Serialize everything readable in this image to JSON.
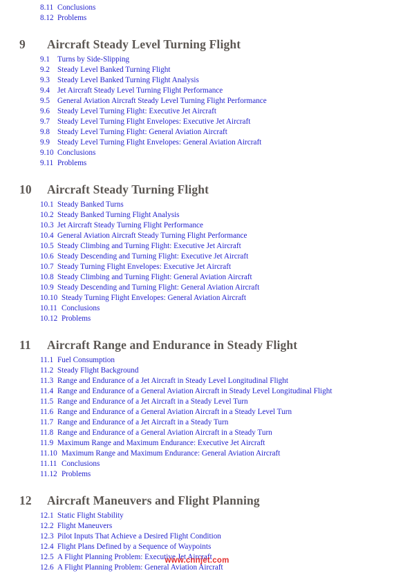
{
  "colors": {
    "section_blue": "#1f1fcc",
    "chapter_gray": "#5c5753",
    "watermark_red": "#e01b1b",
    "page_background": "#ffffff"
  },
  "watermark": {
    "text": "www.cnnjet.com"
  },
  "toc": {
    "leading_sections": [
      {
        "number": "8.11",
        "title": "Conclusions"
      },
      {
        "number": "8.12",
        "title": "Problems"
      }
    ],
    "chapters": [
      {
        "number": "9",
        "title": "Aircraft Steady Level Turning Flight",
        "sections": [
          {
            "number": "9.1",
            "title": "Turns by Side-Slipping"
          },
          {
            "number": "9.2",
            "title": "Steady Level Banked Turning Flight"
          },
          {
            "number": "9.3",
            "title": "Steady Level Banked Turning Flight Analysis"
          },
          {
            "number": "9.4",
            "title": "Jet Aircraft Steady Level Turning Flight Performance"
          },
          {
            "number": "9.5",
            "title": "General Aviation Aircraft Steady Level Turning Flight Performance"
          },
          {
            "number": "9.6",
            "title": "Steady Level Turning Flight: Executive Jet Aircraft"
          },
          {
            "number": "9.7",
            "title": "Steady Level Turning Flight Envelopes: Executive Jet Aircraft"
          },
          {
            "number": "9.8",
            "title": "Steady Level Turning Flight: General Aviation Aircraft"
          },
          {
            "number": "9.9",
            "title": "Steady Level Turning Flight Envelopes: General Aviation Aircraft"
          },
          {
            "number": "9.10",
            "title": "Conclusions"
          },
          {
            "number": "9.11",
            "title": "Problems"
          }
        ]
      },
      {
        "number": "10",
        "title": "Aircraft Steady Turning Flight",
        "sections": [
          {
            "number": "10.1",
            "title": "Steady Banked Turns"
          },
          {
            "number": "10.2",
            "title": "Steady Banked Turning Flight Analysis"
          },
          {
            "number": "10.3",
            "title": "Jet Aircraft Steady Turning Flight Performance"
          },
          {
            "number": "10.4",
            "title": "General Aviation Aircraft Steady Turning Flight Performance"
          },
          {
            "number": "10.5",
            "title": "Steady Climbing and Turning Flight: Executive Jet Aircraft"
          },
          {
            "number": "10.6",
            "title": "Steady Descending and Turning Flight: Executive Jet Aircraft"
          },
          {
            "number": "10.7",
            "title": "Steady Turning Flight Envelopes: Executive Jet Aircraft"
          },
          {
            "number": "10.8",
            "title": "Steady Climbing and Turning Flight: General Aviation Aircraft"
          },
          {
            "number": "10.9",
            "title": "Steady Descending and Turning Flight: General Aviation Aircraft"
          },
          {
            "number": "10.10",
            "title": "Steady Turning Flight Envelopes: General Aviation Aircraft",
            "wide": true
          },
          {
            "number": "10.11",
            "title": "Conclusions",
            "wide": true
          },
          {
            "number": "10.12",
            "title": "Problems",
            "wide": true
          }
        ]
      },
      {
        "number": "11",
        "title": "Aircraft Range and Endurance in Steady Flight",
        "sections": [
          {
            "number": "11.1",
            "title": "Fuel Consumption"
          },
          {
            "number": "11.2",
            "title": "Steady Flight Background"
          },
          {
            "number": "11.3",
            "title": "Range and Endurance of a Jet Aircraft in Steady Level Longitudinal Flight"
          },
          {
            "number": "11.4",
            "title": "Range and Endurance of a General Aviation Aircraft in Steady Level Longitudinal Flight"
          },
          {
            "number": "11.5",
            "title": "Range and Endurance of a Jet Aircraft in a Steady Level Turn"
          },
          {
            "number": "11.6",
            "title": "Range and Endurance of a General Aviation Aircraft in a Steady Level Turn"
          },
          {
            "number": "11.7",
            "title": "Range and Endurance of a Jet Aircraft in a Steady Turn"
          },
          {
            "number": "11.8",
            "title": "Range and Endurance of a General Aviation Aircraft in a Steady Turn"
          },
          {
            "number": "11.9",
            "title": "Maximum Range and Maximum Endurance: Executive Jet Aircraft"
          },
          {
            "number": "11.10",
            "title": "Maximum Range and Maximum Endurance: General Aviation Aircraft",
            "wide": true
          },
          {
            "number": "11.11",
            "title": "Conclusions",
            "wide": true
          },
          {
            "number": "11.12",
            "title": "Problems",
            "wide": true
          }
        ]
      },
      {
        "number": "12",
        "title": "Aircraft Maneuvers and Flight Planning",
        "sections": [
          {
            "number": "12.1",
            "title": "Static Flight Stability"
          },
          {
            "number": "12.2",
            "title": "Flight Maneuvers"
          },
          {
            "number": "12.3",
            "title": "Pilot Inputs That Achieve a Desired Flight Condition"
          },
          {
            "number": "12.4",
            "title": "Flight Plans Defined by a Sequence of Waypoints"
          },
          {
            "number": "12.5",
            "title": "A Flight Planning Problem: Executive Jet Aircraft"
          },
          {
            "number": "12.6",
            "title": "A Flight Planning Problem: General Aviation Aircraft"
          }
        ]
      }
    ]
  }
}
